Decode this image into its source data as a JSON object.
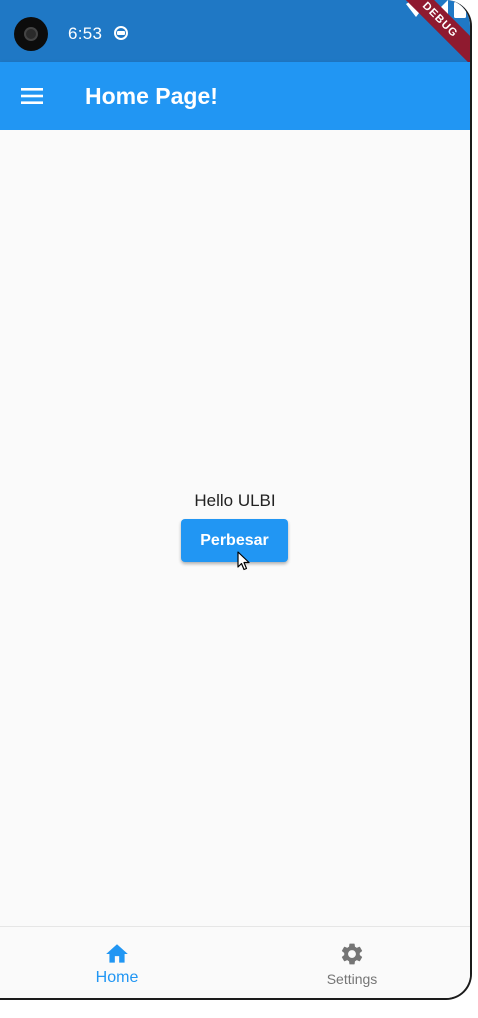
{
  "status_bar": {
    "time": "6:53",
    "background": "#1f78c5",
    "icons": [
      "camera-cutout",
      "notification-icon",
      "wifi-icon",
      "signal-icon",
      "battery-icon"
    ]
  },
  "debug_banner": "DEBUG",
  "app_bar": {
    "title": "Home Page!",
    "menu_icon": "hamburger-menu-icon",
    "background": "#2196f3"
  },
  "main": {
    "greeting": "Hello ULBI",
    "button_label": "Perbesar"
  },
  "bottom_nav": {
    "items": [
      {
        "label": "Home",
        "icon": "home-icon",
        "active": true
      },
      {
        "label": "Settings",
        "icon": "gear-icon",
        "active": false
      }
    ],
    "active_color": "#2196f3",
    "inactive_color": "#757575"
  }
}
